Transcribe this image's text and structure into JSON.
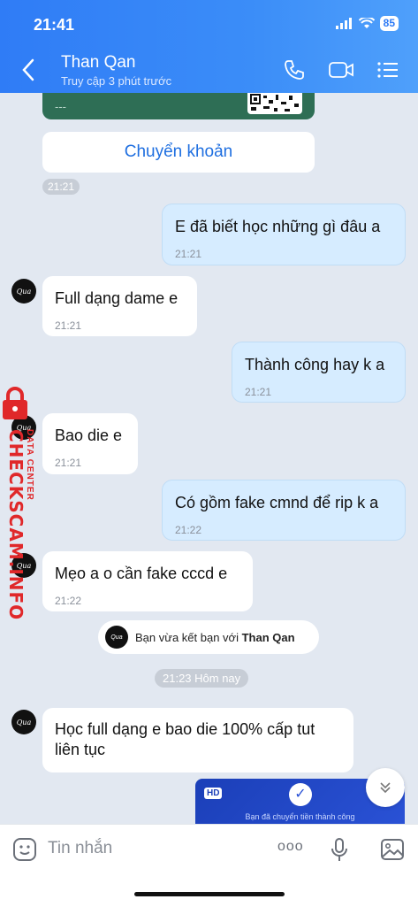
{
  "status": {
    "time": "21:41",
    "battery": "85"
  },
  "header": {
    "name": "Than Qan",
    "subtitle": "Truy cập 3 phút trước"
  },
  "transfer": {
    "card_text": "---",
    "button_label": "Chuyển khoản",
    "time": "21:21"
  },
  "messages": [
    {
      "dir": "out",
      "text": "E đã biết học những gì đâu a",
      "time": "21:21"
    },
    {
      "dir": "in",
      "text": "Full dạng dame e",
      "time": "21:21"
    },
    {
      "dir": "out",
      "text": "Thành công hay k a",
      "time": "21:21"
    },
    {
      "dir": "in",
      "text": "Bao die e",
      "time": "21:21"
    },
    {
      "dir": "out",
      "text": "Có gồm fake cmnd để rip k a",
      "time": "21:22"
    },
    {
      "dir": "in",
      "text": "Mẹo a o cần fake cccd e",
      "time": "21:22"
    },
    {
      "dir": "in",
      "text": "Học full dạng e bao die 100% cấp tut liên tục",
      "time": ""
    }
  ],
  "friend_notice": {
    "prefix": "Bạn vừa kết bạn với",
    "name": "Than Qan"
  },
  "date_separator": "21:23 Hôm nay",
  "image_message": {
    "badge": "HD",
    "caption": "Bạn đã chuyển tiền thành công"
  },
  "watermark": {
    "brand": "CHECKSCAM.INFO",
    "sub": "DATA CENTER"
  },
  "input": {
    "placeholder": "Tin nhắn",
    "more_label": "ooo"
  },
  "icons": [
    "back-arrow-icon",
    "phone-icon",
    "video-icon",
    "menu-list-icon",
    "sticker-icon",
    "microphone-icon",
    "gallery-icon",
    "chevron-double-down-icon",
    "check-icon",
    "lock-icon"
  ]
}
